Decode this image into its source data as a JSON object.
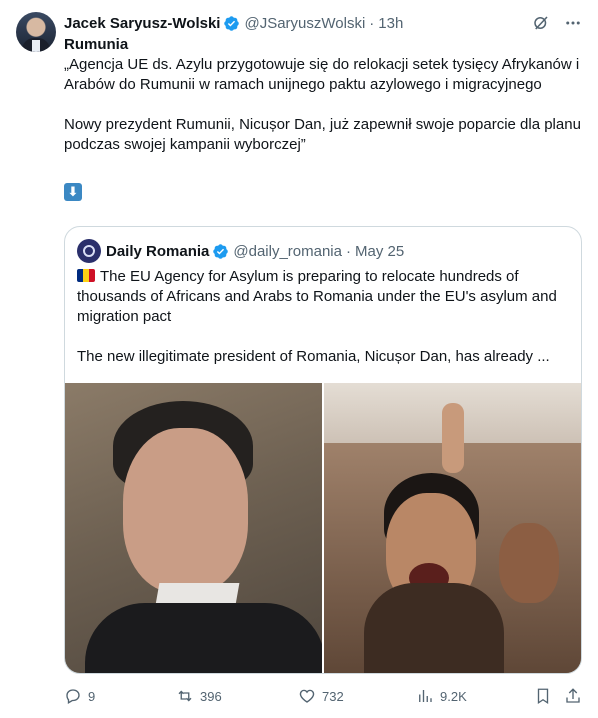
{
  "author": {
    "name": "Jacek Saryusz-Wolski",
    "handle": "@JSaryuszWolski",
    "time": "13h"
  },
  "tweet": {
    "title": "Rumunia",
    "paragraph1": "„Agencja UE ds. Azylu przygotowuje się do relokacji setek tysięcy Afrykanów i Arabów do Rumunii w ramach unijnego paktu azylowego i migracyjnego",
    "paragraph2": "Nowy prezydent Rumunii, Nicușor Dan, już zapewnił swoje poparcie dla planu podczas swojej kampanii wyborczej”",
    "emoji": "⬇"
  },
  "quote": {
    "name": "Daily Romania",
    "handle": "@daily_romania",
    "date": "May 25",
    "paragraph1": "The EU Agency for Asylum is preparing to relocate hundreds of thousands of Africans and Arabs to Romania under the EU's asylum and migration pact",
    "paragraph2": "The new illegitimate president of Romania, Nicușor Dan, has already ..."
  },
  "actions": {
    "replies": "9",
    "reposts": "396",
    "likes": "732",
    "views": "9.2K"
  },
  "colors": {
    "verified": "#1d9bf0",
    "secondary_text": "#536471",
    "border": "#cfd9de"
  }
}
